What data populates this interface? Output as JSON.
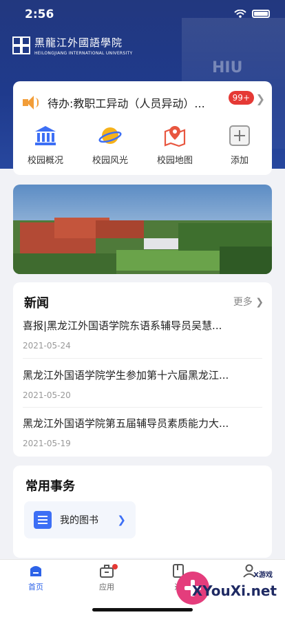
{
  "status_bar": {
    "time": "2:56"
  },
  "header": {
    "logo_cn": "黑龍江外國語學院",
    "logo_en": "HEILONGJIANG INTERNATIONAL UNIVERSITY",
    "deco_text": "HIU"
  },
  "todo": {
    "text": "待办:教职工异动（人员异动）...",
    "badge": "99+"
  },
  "quick_actions": [
    {
      "label": "校园概况",
      "icon": "bank-icon"
    },
    {
      "label": "校园风光",
      "icon": "planet-icon"
    },
    {
      "label": "校园地图",
      "icon": "map-pin-icon"
    },
    {
      "label": "添加",
      "icon": "add-icon"
    }
  ],
  "news": {
    "title": "新闻",
    "more": "更多",
    "items": [
      {
        "title": "喜报|黑龙江外国语学院东语系辅导员吴慧...",
        "date": "2021-05-24"
      },
      {
        "title": "黑龙江外国语学院学生参加第十六届黑龙江...",
        "date": "2021-05-20"
      },
      {
        "title": "黑龙江外国语学院第五届辅导员素质能力大...",
        "date": "2021-05-19"
      }
    ]
  },
  "affairs": {
    "title": "常用事务",
    "items": [
      {
        "label": "我的图书"
      }
    ]
  },
  "tabbar": {
    "tabs": [
      {
        "label": "首页",
        "active": true
      },
      {
        "label": "应用"
      },
      {
        "label": "通"
      },
      {
        "label": ""
      }
    ]
  },
  "watermark": {
    "brand": "X游戏",
    "site": "XYouXi.net"
  },
  "colors": {
    "primary": "#2d63e8",
    "header": "#1f3a8c",
    "badge": "#e53935",
    "accent": "#f29d38"
  }
}
